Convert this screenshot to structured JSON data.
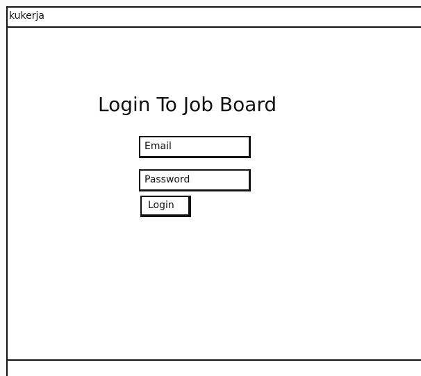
{
  "window": {
    "title": "kukerja"
  },
  "login": {
    "heading": "Login To Job Board",
    "email_label": "Email",
    "password_label": "Password",
    "submit_label": "Login"
  }
}
